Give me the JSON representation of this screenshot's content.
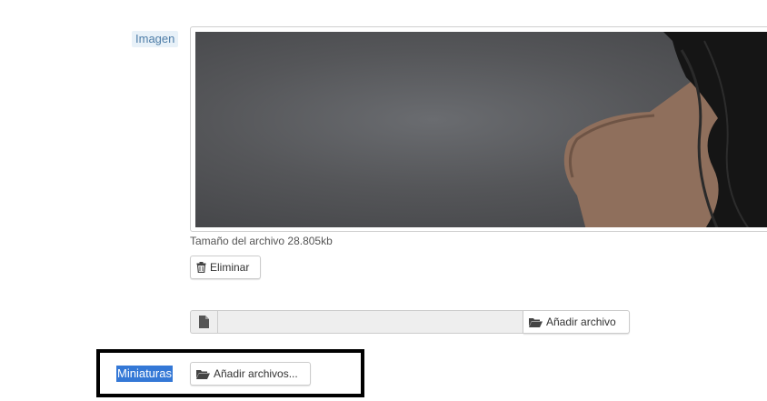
{
  "form": {
    "image_field": {
      "label": "Imagen",
      "file_size_text": "Tamaño del archivo 28.805kb",
      "delete_button_label": "Eliminar"
    },
    "file_upload": {
      "file_icon": "file-icon",
      "file_name_value": "",
      "add_file_button_label": "Añadir archivo",
      "add_file_icon": "folder-open-icon"
    },
    "thumbnails_field": {
      "label": "Miniaturas",
      "add_files_button_label": "Añadir archivos...",
      "add_files_icon": "folder-open-icon"
    }
  },
  "colors": {
    "label_bg": "#e8f1f8",
    "label_text": "#4f7ea8",
    "selection_highlight": "#3478d6",
    "annotation_box": "#000000"
  }
}
